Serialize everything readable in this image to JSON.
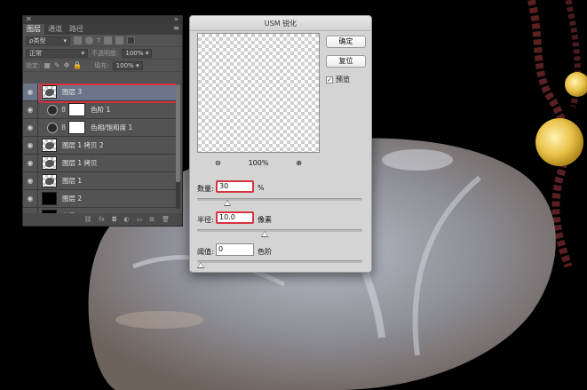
{
  "layers_panel": {
    "tabs": [
      "图层",
      "通道",
      "路径"
    ],
    "filter_kind": "ρ类型",
    "blend_mode": "正常",
    "opacity_label": "不透明度:",
    "opacity_value": "100%",
    "lock_label": "锁定:",
    "fill_label": "填充:",
    "fill_value": "100%",
    "layers": [
      {
        "name": "图层 3",
        "selected": true
      },
      {
        "name": "色阶 1"
      },
      {
        "name": "色相/饱和度 1"
      },
      {
        "name": "图层 1 拷贝 2"
      },
      {
        "name": "图层 1 拷贝"
      },
      {
        "name": "图层 1"
      },
      {
        "name": "图层 2"
      },
      {
        "name": "背景"
      }
    ]
  },
  "usm_dialog": {
    "title": "USM 锐化",
    "ok_label": "确定",
    "reset_label": "复位",
    "preview_label": "预览",
    "preview_checked": true,
    "zoom_value": "100%",
    "amount_label": "数量:",
    "amount_value": "30",
    "amount_unit": "%",
    "radius_label": "半径:",
    "radius_value": "10.0",
    "radius_unit": "像素",
    "threshold_label": "阈值:",
    "threshold_value": "0",
    "threshold_unit": "色阶"
  },
  "colors": {
    "highlight_red": "#d6333e",
    "selected_layer": "#6b7488",
    "panel_bg": "#535353",
    "dialog_bg": "#d4d4d4"
  }
}
